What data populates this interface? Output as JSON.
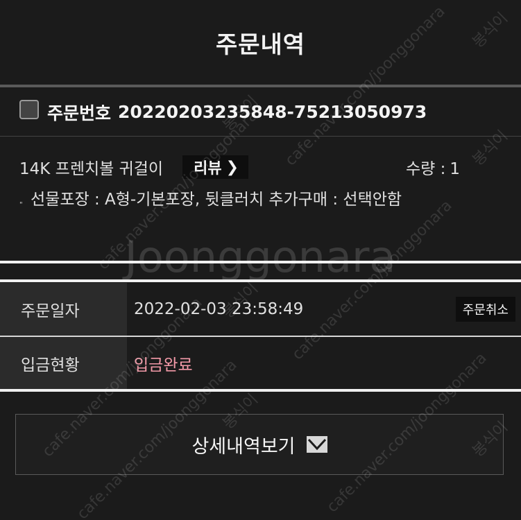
{
  "header": {
    "title": "주문내역"
  },
  "order": {
    "label": "주문번호",
    "number": "20220203235848-75213050973"
  },
  "product": {
    "name": "14K 프렌치볼 귀걸이",
    "review_label": "리뷰",
    "qty_label": "수량 :",
    "qty_value": "1",
    "option_bullet": "\"",
    "option_text": "선물포장 : A형-기본포장, 뒷클러치 추가구매 : 선택안함"
  },
  "info": {
    "order_date_label": "주문일자",
    "order_date_value": "2022-02-03 23:58:49",
    "cancel_label": "주문취소",
    "payment_label": "입금현황",
    "payment_value": "입금완료"
  },
  "detail": {
    "label": "상세내역보기"
  },
  "watermark": {
    "center_text": "Joonggonara",
    "diagonal_text": "cafe.naver.com/joonggonara",
    "seller_text": "봉식이"
  },
  "colors": {
    "payment_status": "#f39aa8",
    "background": "#1b1b1b"
  }
}
